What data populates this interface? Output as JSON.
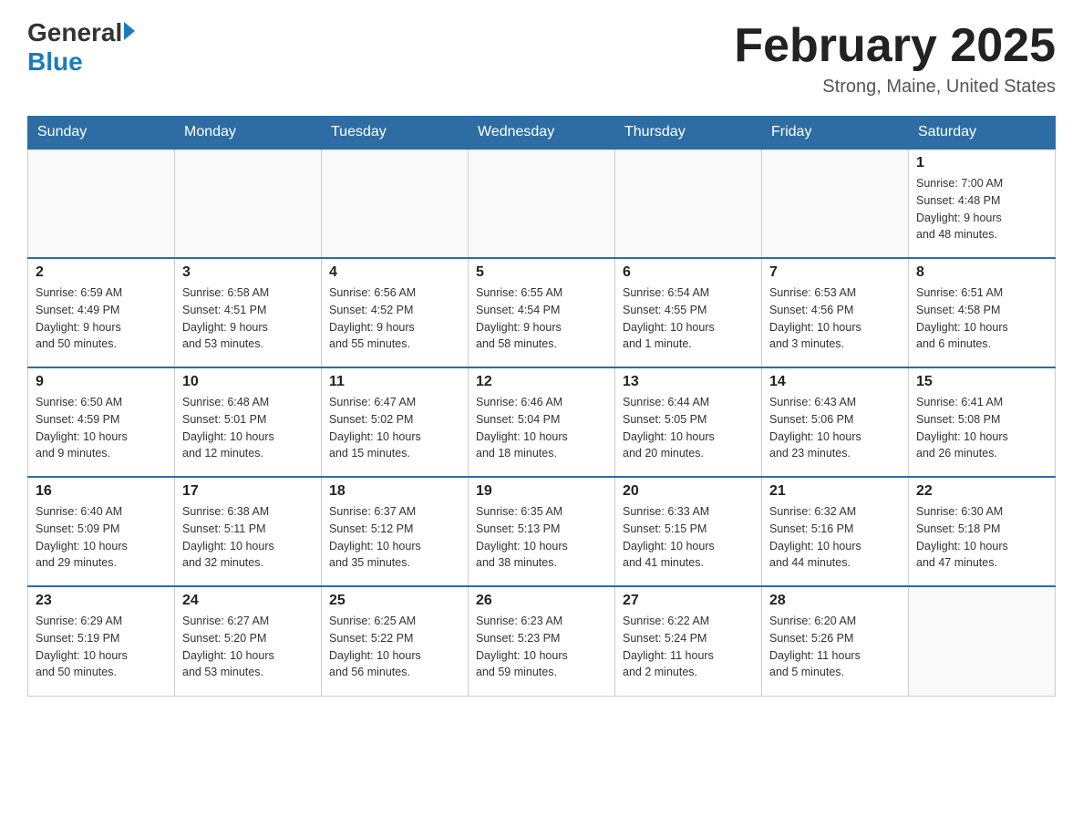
{
  "header": {
    "logo_general": "General",
    "logo_blue": "Blue",
    "title": "February 2025",
    "location": "Strong, Maine, United States"
  },
  "days_of_week": [
    "Sunday",
    "Monday",
    "Tuesday",
    "Wednesday",
    "Thursday",
    "Friday",
    "Saturday"
  ],
  "weeks": [
    [
      {
        "day": "",
        "info": ""
      },
      {
        "day": "",
        "info": ""
      },
      {
        "day": "",
        "info": ""
      },
      {
        "day": "",
        "info": ""
      },
      {
        "day": "",
        "info": ""
      },
      {
        "day": "",
        "info": ""
      },
      {
        "day": "1",
        "info": "Sunrise: 7:00 AM\nSunset: 4:48 PM\nDaylight: 9 hours\nand 48 minutes."
      }
    ],
    [
      {
        "day": "2",
        "info": "Sunrise: 6:59 AM\nSunset: 4:49 PM\nDaylight: 9 hours\nand 50 minutes."
      },
      {
        "day": "3",
        "info": "Sunrise: 6:58 AM\nSunset: 4:51 PM\nDaylight: 9 hours\nand 53 minutes."
      },
      {
        "day": "4",
        "info": "Sunrise: 6:56 AM\nSunset: 4:52 PM\nDaylight: 9 hours\nand 55 minutes."
      },
      {
        "day": "5",
        "info": "Sunrise: 6:55 AM\nSunset: 4:54 PM\nDaylight: 9 hours\nand 58 minutes."
      },
      {
        "day": "6",
        "info": "Sunrise: 6:54 AM\nSunset: 4:55 PM\nDaylight: 10 hours\nand 1 minute."
      },
      {
        "day": "7",
        "info": "Sunrise: 6:53 AM\nSunset: 4:56 PM\nDaylight: 10 hours\nand 3 minutes."
      },
      {
        "day": "8",
        "info": "Sunrise: 6:51 AM\nSunset: 4:58 PM\nDaylight: 10 hours\nand 6 minutes."
      }
    ],
    [
      {
        "day": "9",
        "info": "Sunrise: 6:50 AM\nSunset: 4:59 PM\nDaylight: 10 hours\nand 9 minutes."
      },
      {
        "day": "10",
        "info": "Sunrise: 6:48 AM\nSunset: 5:01 PM\nDaylight: 10 hours\nand 12 minutes."
      },
      {
        "day": "11",
        "info": "Sunrise: 6:47 AM\nSunset: 5:02 PM\nDaylight: 10 hours\nand 15 minutes."
      },
      {
        "day": "12",
        "info": "Sunrise: 6:46 AM\nSunset: 5:04 PM\nDaylight: 10 hours\nand 18 minutes."
      },
      {
        "day": "13",
        "info": "Sunrise: 6:44 AM\nSunset: 5:05 PM\nDaylight: 10 hours\nand 20 minutes."
      },
      {
        "day": "14",
        "info": "Sunrise: 6:43 AM\nSunset: 5:06 PM\nDaylight: 10 hours\nand 23 minutes."
      },
      {
        "day": "15",
        "info": "Sunrise: 6:41 AM\nSunset: 5:08 PM\nDaylight: 10 hours\nand 26 minutes."
      }
    ],
    [
      {
        "day": "16",
        "info": "Sunrise: 6:40 AM\nSunset: 5:09 PM\nDaylight: 10 hours\nand 29 minutes."
      },
      {
        "day": "17",
        "info": "Sunrise: 6:38 AM\nSunset: 5:11 PM\nDaylight: 10 hours\nand 32 minutes."
      },
      {
        "day": "18",
        "info": "Sunrise: 6:37 AM\nSunset: 5:12 PM\nDaylight: 10 hours\nand 35 minutes."
      },
      {
        "day": "19",
        "info": "Sunrise: 6:35 AM\nSunset: 5:13 PM\nDaylight: 10 hours\nand 38 minutes."
      },
      {
        "day": "20",
        "info": "Sunrise: 6:33 AM\nSunset: 5:15 PM\nDaylight: 10 hours\nand 41 minutes."
      },
      {
        "day": "21",
        "info": "Sunrise: 6:32 AM\nSunset: 5:16 PM\nDaylight: 10 hours\nand 44 minutes."
      },
      {
        "day": "22",
        "info": "Sunrise: 6:30 AM\nSunset: 5:18 PM\nDaylight: 10 hours\nand 47 minutes."
      }
    ],
    [
      {
        "day": "23",
        "info": "Sunrise: 6:29 AM\nSunset: 5:19 PM\nDaylight: 10 hours\nand 50 minutes."
      },
      {
        "day": "24",
        "info": "Sunrise: 6:27 AM\nSunset: 5:20 PM\nDaylight: 10 hours\nand 53 minutes."
      },
      {
        "day": "25",
        "info": "Sunrise: 6:25 AM\nSunset: 5:22 PM\nDaylight: 10 hours\nand 56 minutes."
      },
      {
        "day": "26",
        "info": "Sunrise: 6:23 AM\nSunset: 5:23 PM\nDaylight: 10 hours\nand 59 minutes."
      },
      {
        "day": "27",
        "info": "Sunrise: 6:22 AM\nSunset: 5:24 PM\nDaylight: 11 hours\nand 2 minutes."
      },
      {
        "day": "28",
        "info": "Sunrise: 6:20 AM\nSunset: 5:26 PM\nDaylight: 11 hours\nand 5 minutes."
      },
      {
        "day": "",
        "info": ""
      }
    ]
  ]
}
